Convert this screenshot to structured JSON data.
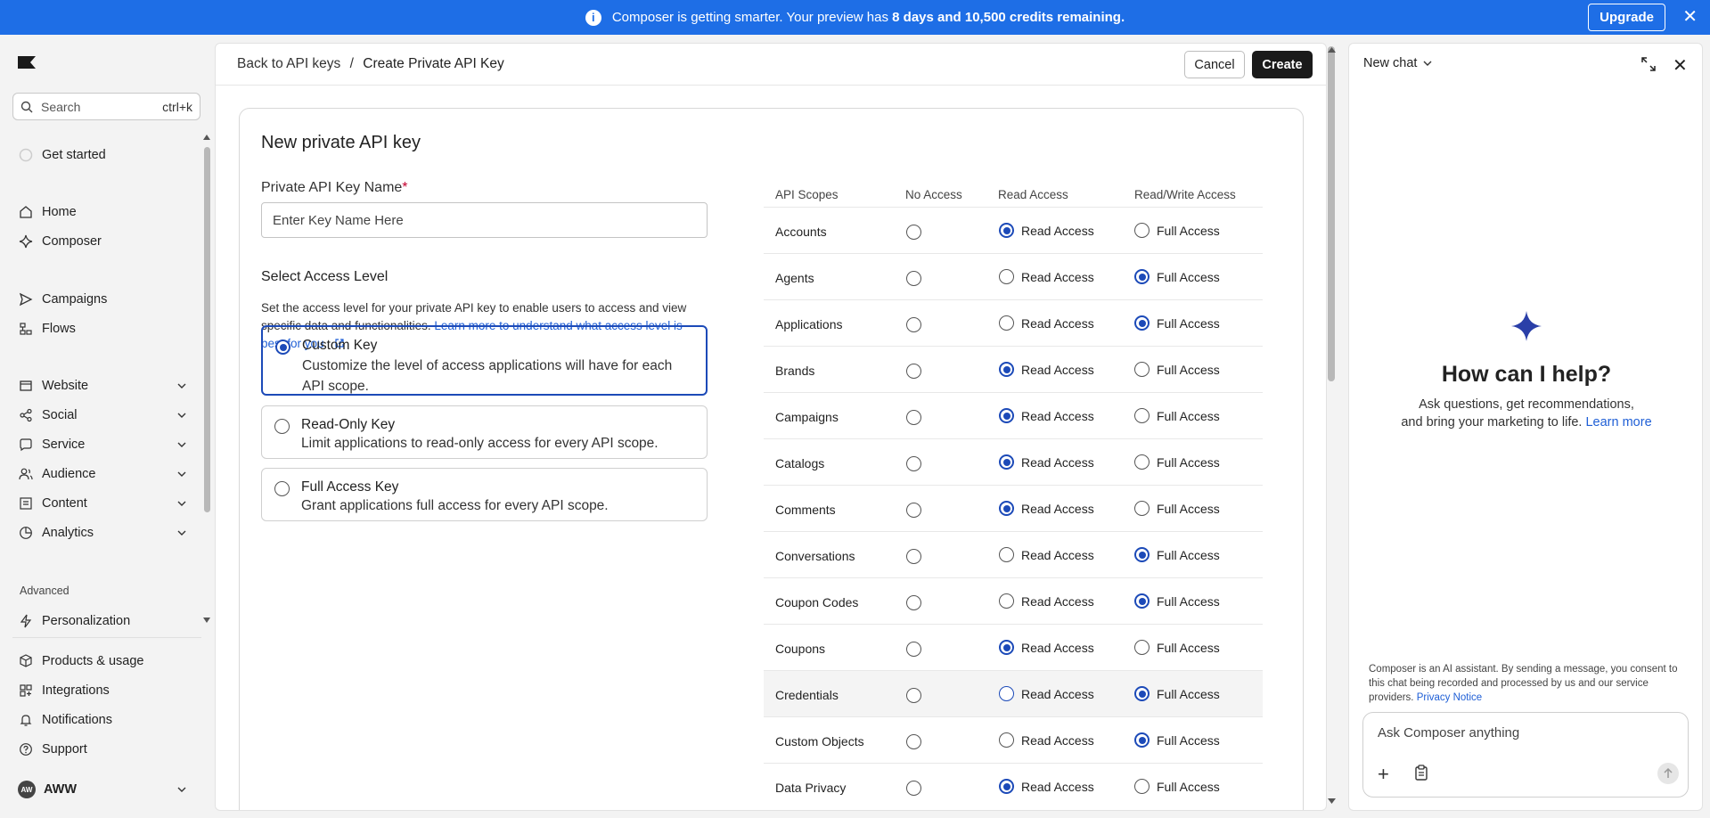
{
  "banner": {
    "prefix": "Composer is getting smarter. Your preview has ",
    "highlight": "8 days and 10,500 credits remaining.",
    "upgrade_label": "Upgrade",
    "bg_color": "#1e6ee6"
  },
  "sidebar": {
    "search_placeholder": "Search",
    "search_shortcut": "ctrl+k",
    "get_started": "Get started",
    "items_top": [
      {
        "label": "Home",
        "icon": "home-icon"
      },
      {
        "label": "Composer",
        "icon": "sparkle-icon"
      }
    ],
    "items_mid": [
      {
        "label": "Campaigns",
        "icon": "send-icon"
      },
      {
        "label": "Flows",
        "icon": "flows-icon"
      }
    ],
    "items_groups": [
      {
        "label": "Website",
        "icon": "website-icon"
      },
      {
        "label": "Social",
        "icon": "social-icon"
      },
      {
        "label": "Service",
        "icon": "service-icon"
      },
      {
        "label": "Audience",
        "icon": "audience-icon"
      },
      {
        "label": "Content",
        "icon": "content-icon"
      },
      {
        "label": "Analytics",
        "icon": "analytics-icon"
      }
    ],
    "advanced_label": "Advanced",
    "personalization": "Personalization",
    "items_bottom": [
      {
        "label": "Products & usage",
        "icon": "products-icon"
      },
      {
        "label": "Integrations",
        "icon": "integrations-icon"
      },
      {
        "label": "Notifications",
        "icon": "bell-icon"
      },
      {
        "label": "Support",
        "icon": "help-icon"
      }
    ],
    "account": {
      "initials": "AW",
      "name": "AWW"
    }
  },
  "header": {
    "back_label": "Back to API keys",
    "separator": "/",
    "current": "Create Private API Key",
    "cancel_label": "Cancel",
    "create_label": "Create"
  },
  "form": {
    "title": "New private API key",
    "name_label": "Private API Key Name",
    "required_mark": "*",
    "name_placeholder": "Enter Key Name Here",
    "access_title": "Select Access Level",
    "access_desc": "Set the access level for your private API key to enable users to access and view specific data and functionalities. ",
    "access_link": "Learn more to understand what access level is best for you.",
    "options": [
      {
        "title": "Custom Key",
        "desc": "Customize the level of access applications will have for each API scope.",
        "selected": true
      },
      {
        "title": "Read-Only Key",
        "desc": "Limit applications to read-only access for every API scope.",
        "selected": false
      },
      {
        "title": "Full Access Key",
        "desc": "Grant applications full access for every API scope.",
        "selected": false
      }
    ]
  },
  "scopes": {
    "headers": [
      "API Scopes",
      "No Access",
      "Read Access",
      "Read/Write Access"
    ],
    "read_label": "Read Access",
    "full_label": "Full Access",
    "rows": [
      {
        "name": "Accounts",
        "value": "read"
      },
      {
        "name": "Agents",
        "value": "full"
      },
      {
        "name": "Applications",
        "value": "full"
      },
      {
        "name": "Brands",
        "value": "read"
      },
      {
        "name": "Campaigns",
        "value": "read"
      },
      {
        "name": "Catalogs",
        "value": "read"
      },
      {
        "name": "Comments",
        "value": "read"
      },
      {
        "name": "Conversations",
        "value": "full"
      },
      {
        "name": "Coupon Codes",
        "value": "full"
      },
      {
        "name": "Coupons",
        "value": "read"
      },
      {
        "name": "Credentials",
        "value": "full",
        "hover": true
      },
      {
        "name": "Custom Objects",
        "value": "full"
      },
      {
        "name": "Data Privacy",
        "value": "read"
      }
    ]
  },
  "chat": {
    "title": "New chat",
    "help_title": "How can I help?",
    "help_line1": "Ask questions, get recommendations,",
    "help_line2": "and bring your marketing to life. ",
    "learn_more": "Learn more",
    "disclaimer": "Composer is an AI assistant. By sending a message, you consent to this chat being recorded and processed by us and our service providers. ",
    "privacy_link": "Privacy Notice",
    "input_placeholder": "Ask Composer anything"
  }
}
